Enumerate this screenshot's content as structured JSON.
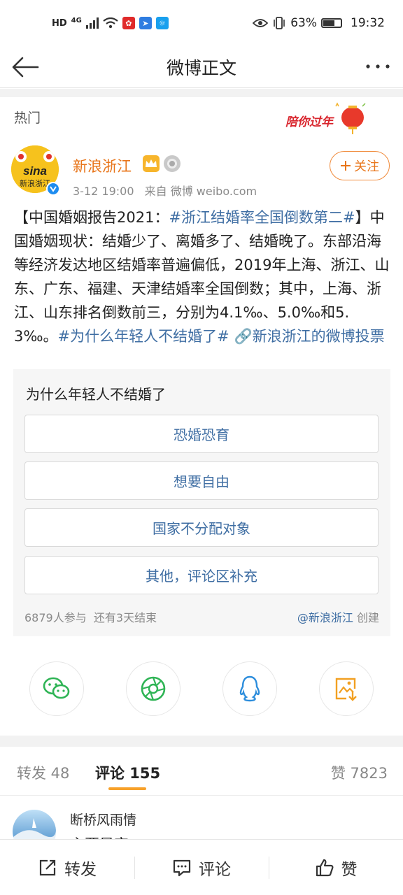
{
  "status_bar": {
    "network": "4G",
    "network_badge": "HD",
    "battery": "63%",
    "battery_level": 0.63,
    "time": "19:32"
  },
  "nav": {
    "title": "微博正文",
    "back_icon": "back-arrow-icon",
    "more_icon": "more-dots-icon"
  },
  "section": {
    "label": "热门",
    "festival_text": "陪你过年"
  },
  "author": {
    "name": "新浪浙江",
    "avatar_text": "sina 新浪浙江",
    "time": "3-12 19:00",
    "source": "来自 微博 weibo.com",
    "follow_label": "关注",
    "follow_icon": "plus-icon"
  },
  "post": {
    "p1": "【中国婚姻报告2021：",
    "topic1": "#浙江结婚率全国倒数第二#",
    "p2": "】中国婚姻现状：结婚少了、离婚多了、结婚晚了。东部沿海等经济发达地区结婚率普遍偏低，2019年上海、浙江、山东、广东、福建、天津结婚率全国倒数；其中，上海、浙江、山东排名倒数前三，分别为4.1‰、5.0‰和5.3‰。",
    "topic2": "#为什么年轻人不结婚了#",
    "link": "🔗新浪浙江的微博投票"
  },
  "vote": {
    "question": "为什么年轻人不结婚了",
    "options": [
      "恐婚恐育",
      "想要自由",
      "国家不分配对象",
      "其他，评论区补充"
    ],
    "participants": "6879人参与",
    "remaining": "还有3天结束",
    "creator": "@新浪浙江",
    "creator_suffix": "创建"
  },
  "share": {
    "buttons": [
      "wechat-icon",
      "moments-icon",
      "qq-icon",
      "save-image-icon"
    ]
  },
  "tabs": {
    "repost": "转发 48",
    "comment": "评论 155",
    "like": "赞 7823"
  },
  "comment": {
    "name": "断桥风雨情",
    "text": "主要是穷"
  },
  "bottom": {
    "repost": "转发",
    "comment": "评论",
    "like": "赞"
  },
  "colors": {
    "orange": "#e8751a",
    "link_blue": "#3f6ea3",
    "tab_indicator": "#f7a12a"
  }
}
